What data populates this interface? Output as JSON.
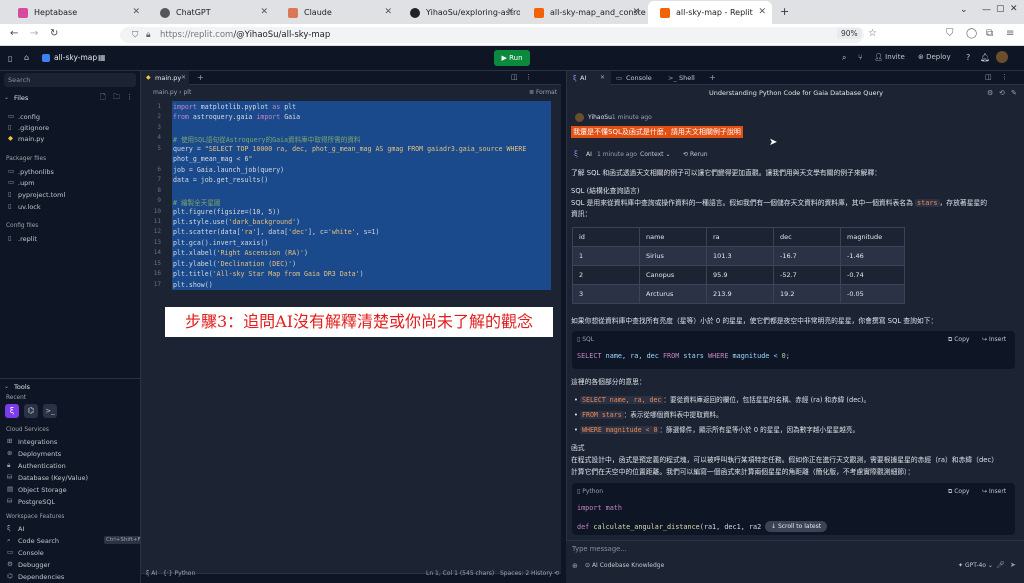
{
  "browser": {
    "tabs": [
      {
        "label": "Heptabase",
        "color": "#d84a9b"
      },
      {
        "label": "ChatGPT",
        "color": "#555"
      },
      {
        "label": "Claude",
        "color": "#d97757"
      },
      {
        "label": "YihaoSu/exploring-astro",
        "color": "#222"
      },
      {
        "label": "all-sky-map_and_conste",
        "color": "#f26207"
      },
      {
        "label": "all-sky-map - Replit",
        "color": "#f26207"
      }
    ],
    "url_host": "https://replit.com",
    "url_path": "/@YihaoSu/all-sky-map",
    "zoom": "90%"
  },
  "replit": {
    "project": "all-sky-map",
    "run_label": "Run",
    "invite_label": "Invite",
    "deploy_label": "Deploy"
  },
  "sidebar": {
    "search_placeholder": "Search",
    "files_header": "Files",
    "files": [
      ".config",
      ".gitignore",
      "main.py"
    ],
    "packager_header": "Packager files",
    "packager": [
      ".pythonlibs",
      ".upm",
      "pyproject.toml",
      "uv.lock"
    ],
    "config_header": "Config files",
    "config": [
      ".replit"
    ],
    "tools_header": "Tools",
    "recent": "Recent",
    "cloud_header": "Cloud Services",
    "cloud": [
      "Integrations",
      "Deployments",
      "Authentication",
      "Database (Key/Value)",
      "Object Storage",
      "PostgreSQL"
    ],
    "workspace_header": "Workspace Features",
    "workspace": [
      "AI",
      "Code Search",
      "Console",
      "Debugger",
      "Dependencies"
    ],
    "code_search_shortcut": "Ctrl+Shift+F"
  },
  "editor": {
    "tab": "main.py",
    "breadcrumb_file": "main.py",
    "breadcrumb_sym": "plt",
    "format_label": "Format",
    "lines": [
      "import matplotlib.pyplot as plt",
      "from astroquery.gaia import Gaia",
      "",
      "# 使用SQL語句從Astroquery的Gaia資料庫中取得所需的資料",
      "query = \"SELECT TOP 10000 ra, dec, phot_g_mean_mag AS gmag FROM gaiadr3.gaia_source WHERE",
      "phot_g_mean_mag < 6\"",
      "job = Gaia.launch_job(query)",
      "data = job.get_results()",
      "",
      "# 繪製全天星圖",
      "plt.figure(figsize=(10, 5))",
      "plt.style.use('dark_background')",
      "plt.scatter(data['ra'], data['dec'], c='white', s=1)",
      "plt.gca().invert_xaxis()",
      "plt.xlabel('Right Ascension (RA)')",
      "plt.ylabel('Declination (DEC)')",
      "plt.title('All-sky Star Map from Gaia DR3 Data')",
      "plt.show()"
    ],
    "line_numbers": [
      "1",
      "2",
      "3",
      "4",
      "5",
      "",
      "6",
      "7",
      "8",
      "9",
      "10",
      "11",
      "12",
      "13",
      "14",
      "15",
      "16",
      "17"
    ],
    "annotation": "步驟3：追問AI沒有解釋清楚或你尚未了解的觀念",
    "status_ai": "AI",
    "status_lang": "Python",
    "status_pos": "Ln 1, Col 1 (545 chars)",
    "status_spaces": "Spaces: 2",
    "status_history": "History"
  },
  "ai_panel": {
    "tabs": [
      "AI",
      "Console",
      "Shell"
    ],
    "title": "Understanding Python Code for Gaia Database Query",
    "user": "YihaoSu",
    "user_time": "1 minute ago",
    "user_msg": "我還是不懂SQL及函式是什麼，請用天文相關例子說明",
    "ai_label": "AI",
    "ai_time": "1 minute ago",
    "context_label": "Context",
    "rerun_label": "Rerun",
    "p1": "了解 SQL 和函式透過天文相關的例子可以讓它們變得更加直觀。讓我們用與天文學有關的例子來解釋：",
    "sql_heading": "SQL (結構化查詢語言)",
    "sql_desc_a": "SQL 是用來從資料庫中查詢或操作資料的一種語言。假如我們有一個儲存天文資料的資料庫，其中一個資料表名為",
    "sql_desc_code": "stars",
    "sql_desc_b": "，存放著星星的",
    "sql_desc_c": "資訊：",
    "table_headers": [
      "id",
      "name",
      "ra",
      "dec",
      "magnitude"
    ],
    "table_rows": [
      [
        "1",
        "Sirius",
        "101.3",
        "-16.7",
        "-1.46"
      ],
      [
        "2",
        "Canopus",
        "95.9",
        "-52.7",
        "-0.74"
      ],
      [
        "3",
        "Arcturus",
        "213.9",
        "19.2",
        "-0.05"
      ]
    ],
    "p2": "如果你想從資料庫中查找所有亮度（星等）小於 0 的星星，使它們都是夜空中非常明亮的星星，你會撰寫 SQL 查詢如下：",
    "code1_lang": "SQL",
    "copy_label": "Copy",
    "insert_label": "Insert",
    "code1": "SELECT name, ra, dec FROM stars WHERE magnitude < 0;",
    "p3": "這裡的各個部分的意思：",
    "b1_code": "SELECT name, ra, dec",
    "b1": "：要從資料庫返回的欄位，包括星星的名稱、赤經 (ra) 和赤緯 (dec)。",
    "b2_code": "FROM stars",
    "b2": "：表示從哪個資料表中提取資料。",
    "b3_code": "WHERE magnitude < 0",
    "b3": "：篩選條件，顯示所有星等小於 0 的星星，因為數字越小星星越亮。",
    "func_heading": "函式",
    "func_p1": "在程式設計中，函式是預定義的程式塊，可以被呼叫執行某項特定任務。假如你正在進行天文觀測，需要根據星星的赤經（ra）和赤緯（dec）",
    "func_p2": "計算它們在天空中的位置距離。我們可以編寫一個函式來計算兩個星星的角距離（簡化版，不考慮實際觀測細節）：",
    "code2_lang": "Python",
    "code2_l1": "import math",
    "code2_l3": "def calculate_angular_distance(ra1, dec1, ra2",
    "scroll_latest": "Scroll to latest",
    "input_placeholder": "Type message...",
    "knowledge_label": "AI Codebase Knowledge",
    "model_label": "GPT-4o"
  }
}
